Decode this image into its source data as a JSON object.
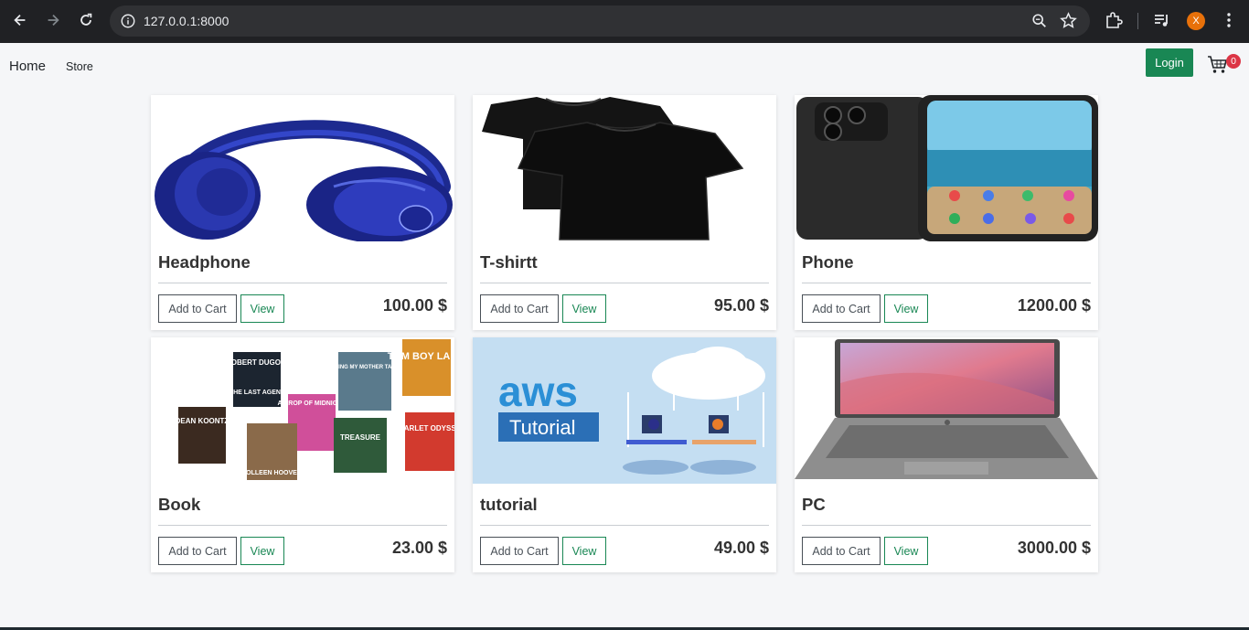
{
  "browser": {
    "url": "127.0.0.1:8000",
    "profile_initial": "X",
    "profile_color": "#e8710a"
  },
  "navbar": {
    "home_label": "Home",
    "store_label": "Store",
    "login_label": "Login",
    "cart_count": "0",
    "accent_color": "#198754",
    "badge_color": "#dc3545"
  },
  "products": [
    {
      "name": "Headphone",
      "price": "100.00 $",
      "image": "headphone-image",
      "add_label": "Add to Cart",
      "view_label": "View"
    },
    {
      "name": "T-shirtt",
      "price": "95.00 $",
      "image": "tshirt-image",
      "add_label": "Add to Cart",
      "view_label": "View"
    },
    {
      "name": "Phone",
      "price": "1200.00 $",
      "image": "phone-image",
      "add_label": "Add to Cart",
      "view_label": "View"
    },
    {
      "name": "Book",
      "price": "23.00 $",
      "image": "books-image",
      "add_label": "Add to Cart",
      "view_label": "View"
    },
    {
      "name": "tutorial",
      "price": "49.00 $",
      "image": "aws-tutorial-image",
      "add_label": "Add to Cart",
      "view_label": "View"
    },
    {
      "name": "PC",
      "price": "3000.00 $",
      "image": "laptop-image",
      "add_label": "Add to Cart",
      "view_label": "View"
    }
  ],
  "image_text": {
    "book_1": "ROBERT DUGONI",
    "book_1_title": "THE LAST AGENT",
    "book_2": "DEAN KOONTZ",
    "book_3": "A DROP OF MIDNIGHT",
    "book_4": "EVERYTHING MY MOTHER TAUGHT ME",
    "book_5": "TOM BOY LAND",
    "book_6": "TREASURE",
    "book_7": "SCARLET ODYSSEY",
    "book_8": "COLLEEN HOOVER",
    "aws_logo": "aws",
    "aws_sub": "Tutorial"
  }
}
